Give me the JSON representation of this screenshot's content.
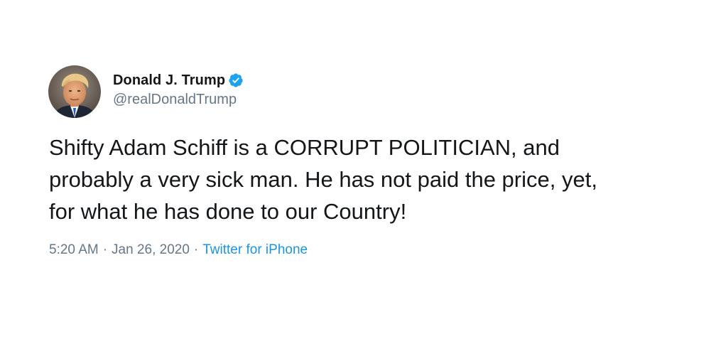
{
  "tweet": {
    "author": {
      "display_name": "Donald J. Trump",
      "handle": "@realDonaldTrump",
      "verified_icon": "verified-badge-icon",
      "avatar_icon": "avatar"
    },
    "text": "Shifty Adam Schiff is a CORRUPT POLITICIAN, and\nprobably a very sick man. He has not paid the price, yet,\nfor what he has done to our Country!",
    "meta": {
      "time": "5:20 AM",
      "separator": "·",
      "date": "Jan 26, 2020",
      "source": "Twitter for iPhone"
    }
  },
  "colors": {
    "text_primary": "#14171a",
    "text_secondary": "#657786",
    "link": "#1b95e0",
    "verified": "#1da1f2",
    "background": "#ffffff"
  }
}
